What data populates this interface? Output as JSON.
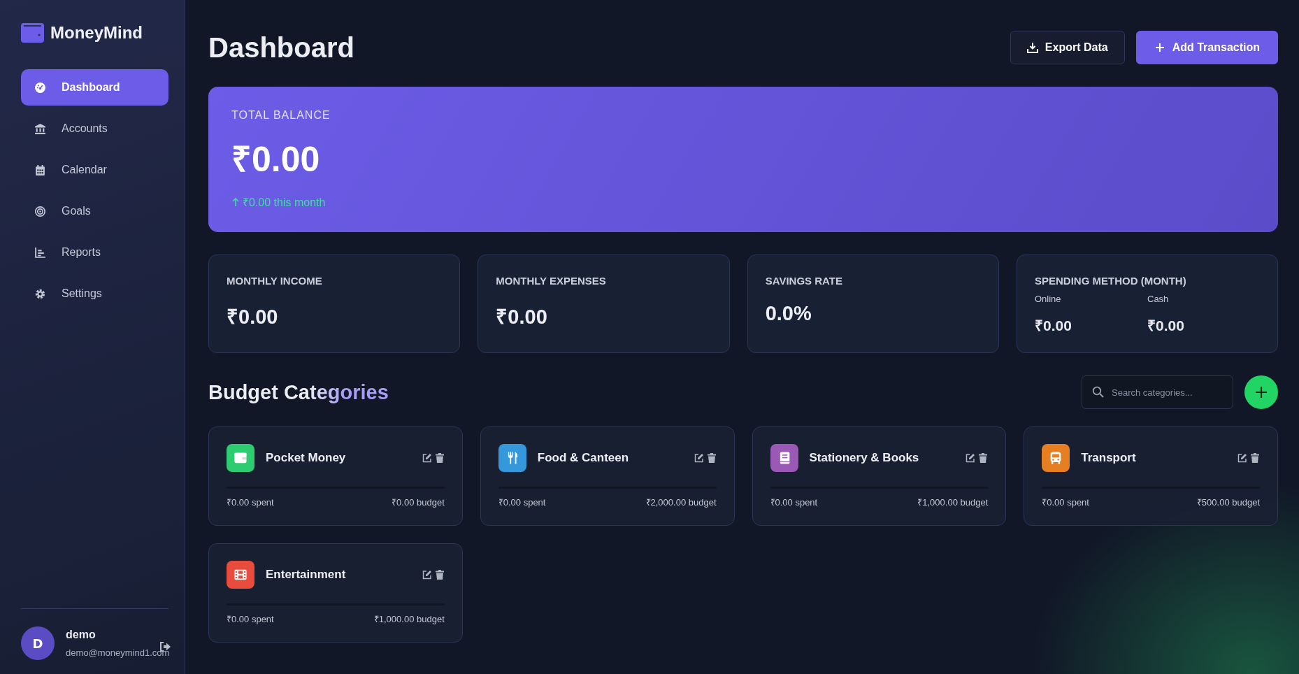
{
  "brand": {
    "name": "MoneyMind"
  },
  "nav": [
    {
      "label": "Dashboard",
      "selected": true
    },
    {
      "label": "Accounts",
      "selected": false
    },
    {
      "label": "Calendar",
      "selected": false
    },
    {
      "label": "Goals",
      "selected": false
    },
    {
      "label": "Reports",
      "selected": false
    },
    {
      "label": "Settings",
      "selected": false
    }
  ],
  "user": {
    "initial": "D",
    "name": "demo",
    "email": "demo@moneymind1.com"
  },
  "header": {
    "title": "Dashboard",
    "buttons": [
      {
        "kind": "export",
        "label": "Export Data"
      },
      {
        "kind": "add",
        "label": "Add Transaction"
      }
    ]
  },
  "balance": {
    "label": "TOTAL BALANCE",
    "amount": "₹0.00",
    "change": "₹0.00 this month"
  },
  "stats": [
    {
      "kind": "single",
      "label": "MONTHLY INCOME",
      "value": "₹0.00"
    },
    {
      "kind": "single",
      "label": "MONTHLY EXPENSES",
      "value": "₹0.00"
    },
    {
      "kind": "single",
      "label": "SAVINGS RATE",
      "value": "0.0%"
    },
    {
      "kind": "split",
      "label": "SPENDING METHOD (MONTH)",
      "parts": [
        {
          "label": "Online",
          "value": "₹0.00"
        },
        {
          "label": "Cash",
          "value": "₹0.00"
        }
      ]
    }
  ],
  "budget": {
    "title": "Budget Categories",
    "search": {
      "placeholder": "Search categories..."
    },
    "categories": [
      {
        "kind": "wallet",
        "name": "Pocket Money",
        "color": "#2ecc71",
        "level": 0,
        "spent": "₹0.00 spent",
        "budget": "₹0.00 budget"
      },
      {
        "kind": "food",
        "name": "Food & Canteen",
        "color": "#3498db",
        "level": 0,
        "spent": "₹0.00 spent",
        "budget": "₹2,000.00 budget"
      },
      {
        "kind": "book",
        "name": "Stationery & Books",
        "color": "#9b59b6",
        "level": 0,
        "spent": "₹0.00 spent",
        "budget": "₹1,000.00 budget"
      },
      {
        "kind": "bus",
        "name": "Transport",
        "color": "#e67e22",
        "level": 0,
        "spent": "₹0.00 spent",
        "budget": "₹500.00 budget"
      },
      {
        "kind": "film",
        "name": "Entertainment",
        "color": "#e74c3c",
        "level": 0,
        "spent": "₹0.00 spent",
        "budget": "₹1,000.00 budget"
      }
    ]
  }
}
